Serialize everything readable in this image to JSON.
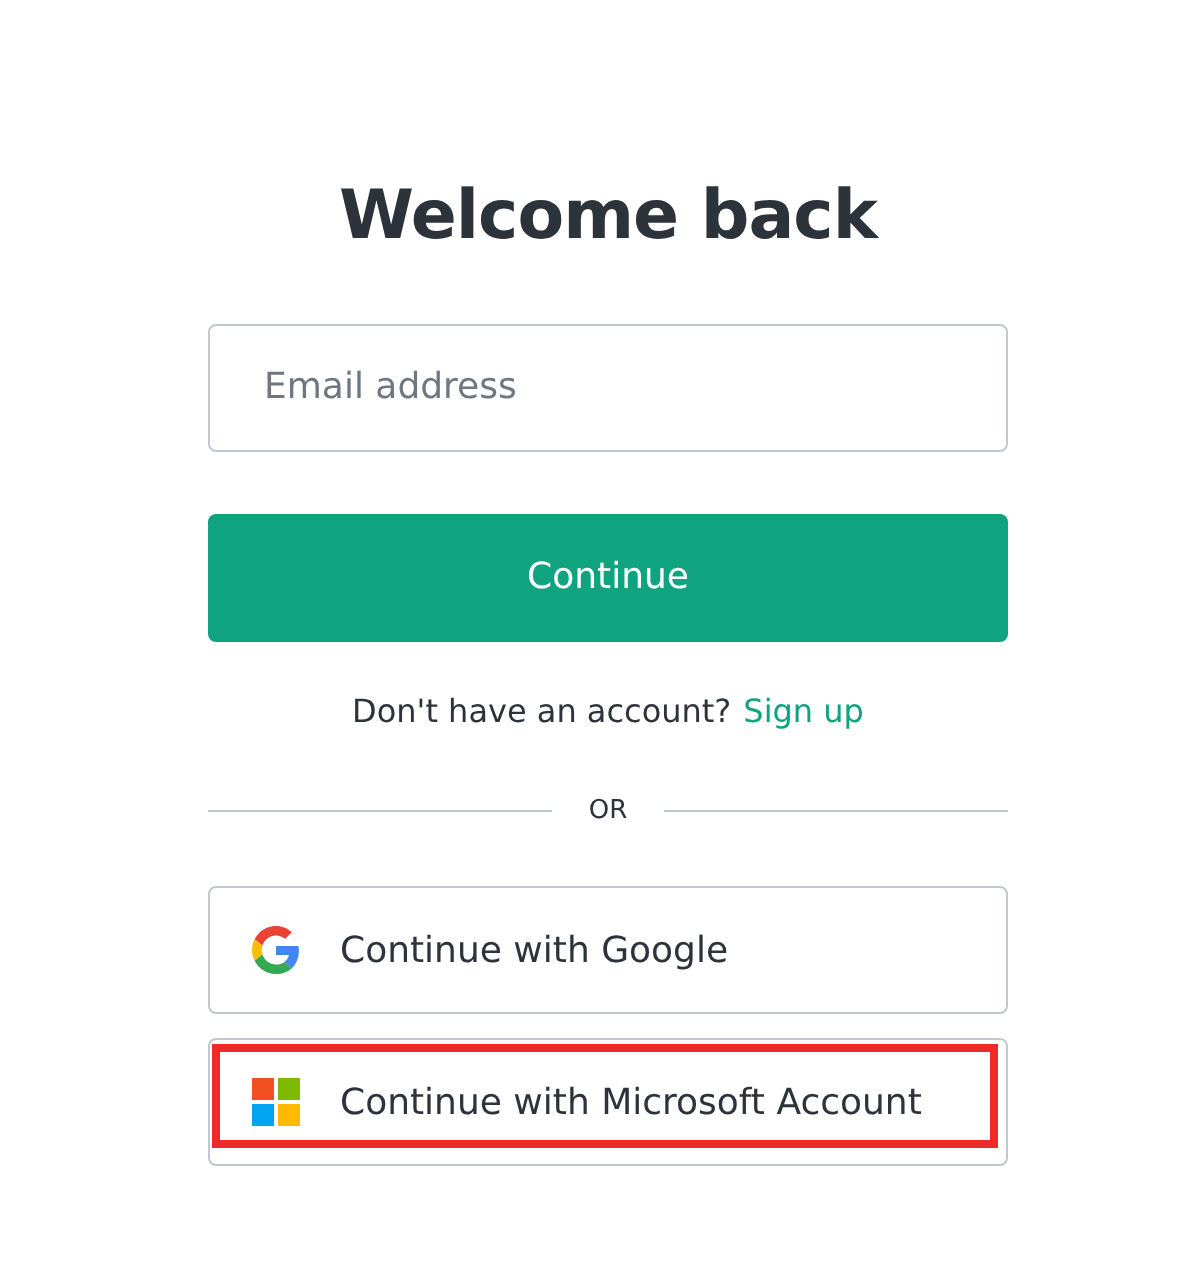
{
  "title": "Welcome back",
  "email": {
    "placeholder": "Email address"
  },
  "continue_button": "Continue",
  "signup": {
    "prompt": "Don't have an account?",
    "link": "Sign up"
  },
  "divider": "OR",
  "providers": [
    {
      "kind": "google",
      "label": "Continue with Google",
      "highlighted": false
    },
    {
      "kind": "microsoft",
      "label": "Continue with Microsoft Account",
      "highlighted": true
    }
  ]
}
